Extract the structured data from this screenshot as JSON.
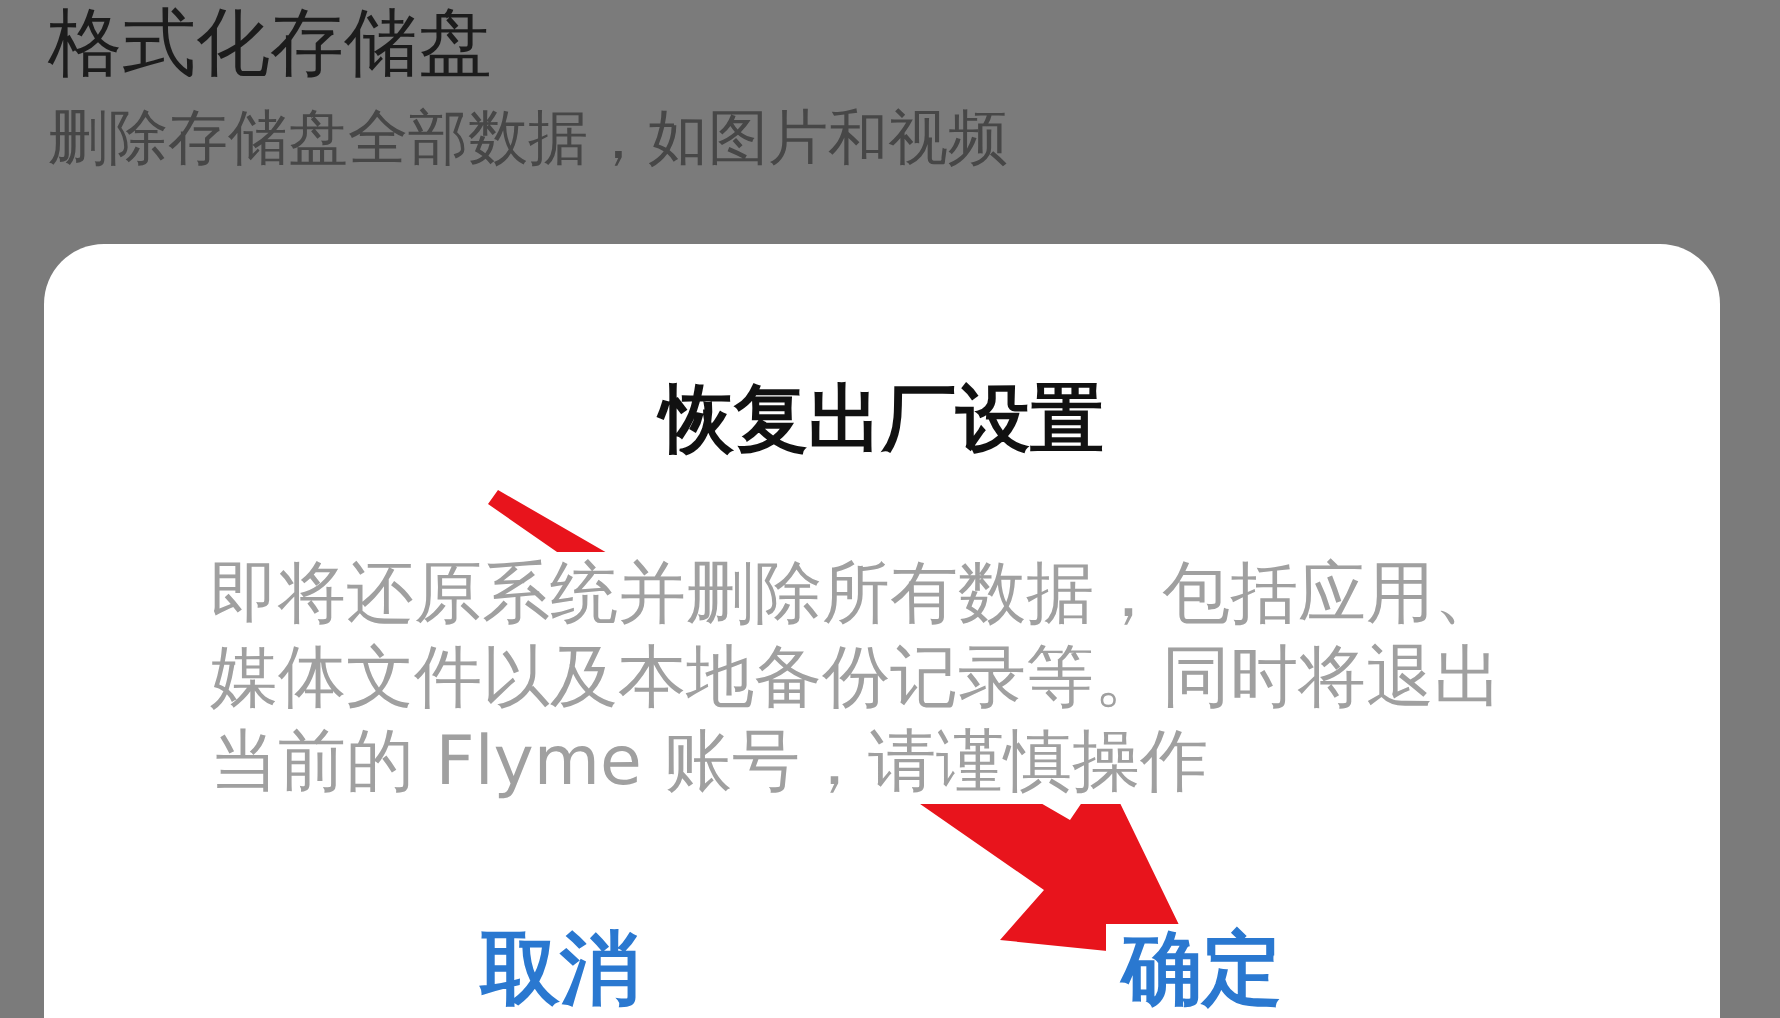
{
  "background_setting": {
    "title": "格式化存储盘",
    "description": "删除存储盘全部数据，如图片和视频"
  },
  "dialog": {
    "title": "恢复出厂设置",
    "message": "即将还原系统并删除所有数据，包括应用、媒体文件以及本地备份记录等。同时将退出当前的 Flyme 账号，请谨慎操作",
    "buttons": [
      {
        "label": "取消"
      },
      {
        "label": "确定"
      }
    ]
  }
}
